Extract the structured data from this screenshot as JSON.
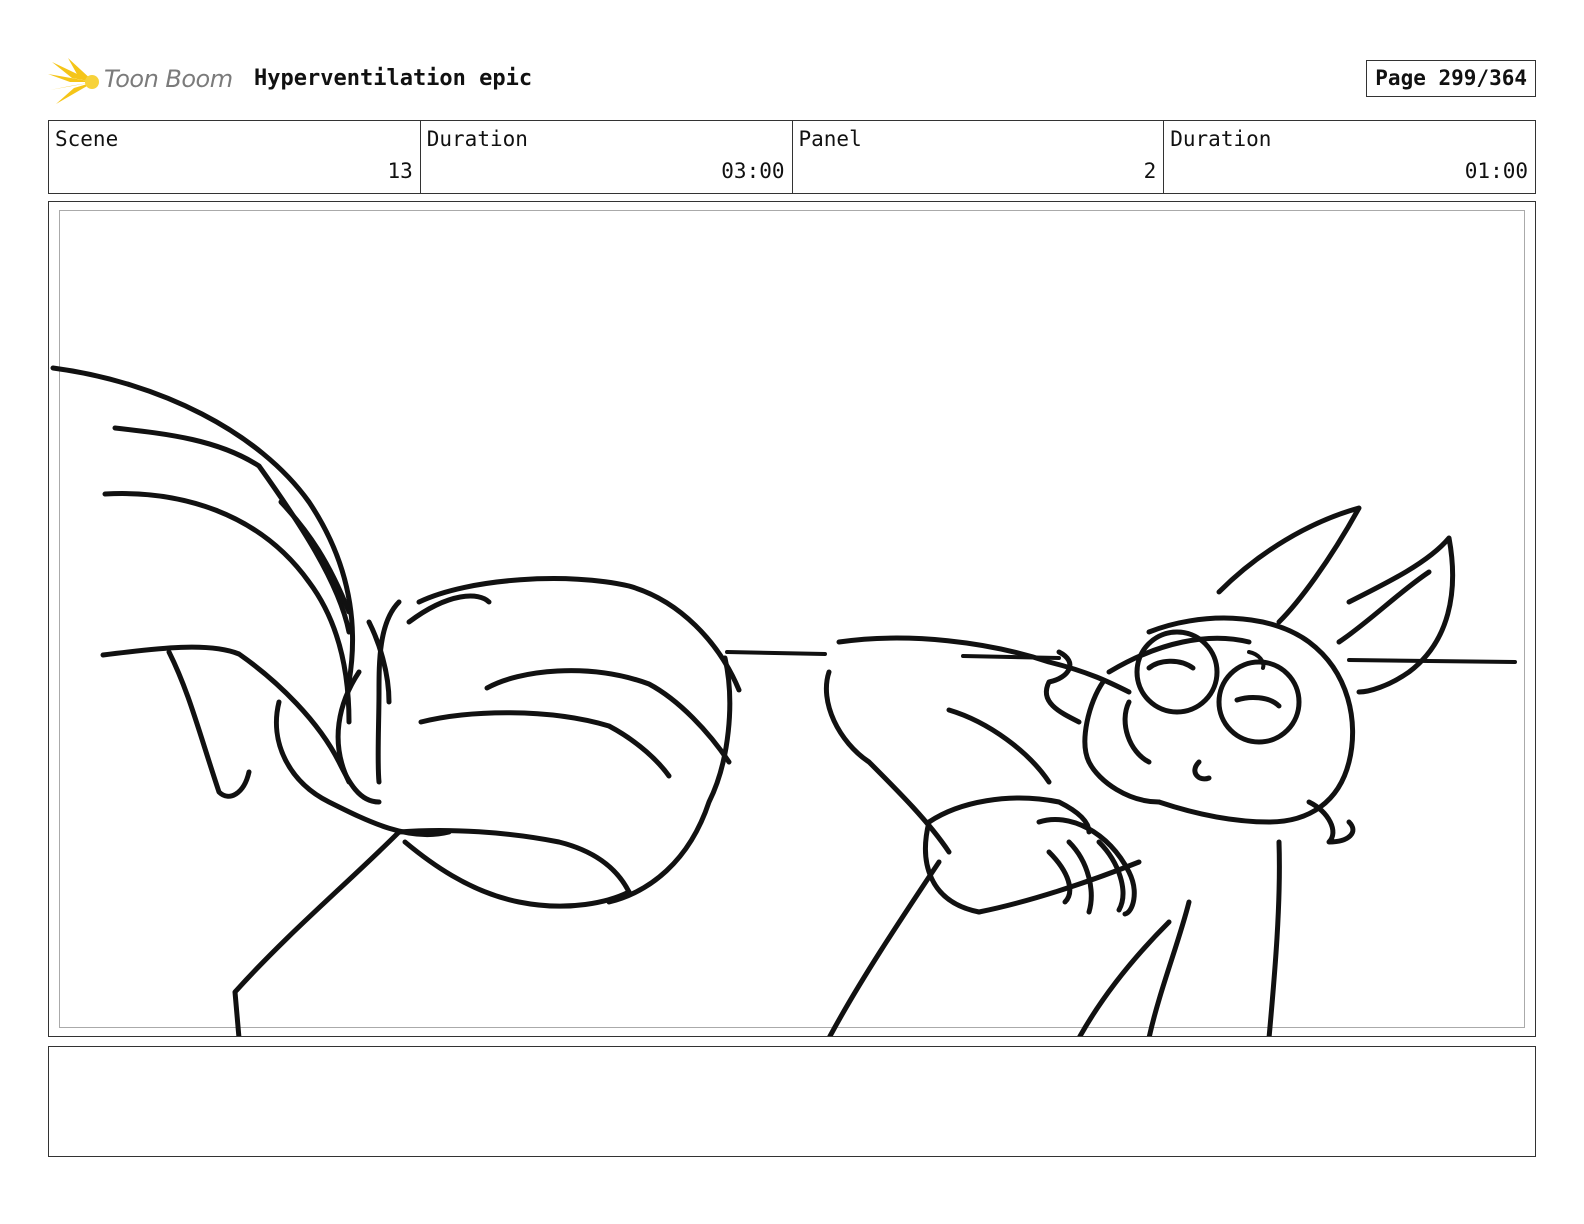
{
  "header": {
    "logo_text": "Toon Boom",
    "title": "Hyperventilation epic",
    "page_label": "Page 299/364"
  },
  "info": [
    {
      "label": "Scene",
      "value": "13"
    },
    {
      "label": "Duration",
      "value": "03:00"
    },
    {
      "label": "Panel",
      "value": "2"
    },
    {
      "label": "Duration",
      "value": "01:00"
    }
  ],
  "notes": "",
  "colors": {
    "logo_star": "#f5c518",
    "logo_text": "#7b7b7b",
    "border": "#333333",
    "inner_border": "#aaaaaa",
    "sketch_ink": "#111111"
  }
}
